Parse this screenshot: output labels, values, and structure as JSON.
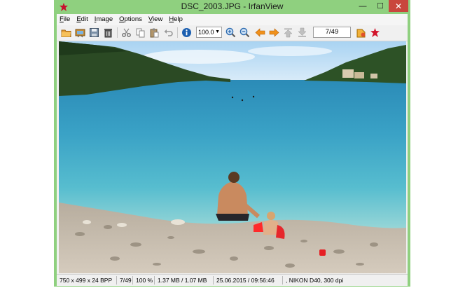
{
  "window": {
    "title": "DSC_2003.JPG - IrfanView",
    "controls": {
      "minimize": "—",
      "maximize": "☐",
      "close": "✕"
    }
  },
  "menu": [
    {
      "label_rest": "ile",
      "accel": "F"
    },
    {
      "label_rest": "dit",
      "accel": "E"
    },
    {
      "label_rest": "mage",
      "accel": "I"
    },
    {
      "label_rest": "ptions",
      "accel": "O"
    },
    {
      "label_rest": "iew",
      "accel": "V"
    },
    {
      "label_rest": "elp",
      "accel": "H"
    }
  ],
  "toolbar": {
    "zoom_value": "100.0",
    "page_counter": "7/49",
    "icons": [
      "open-folder-icon",
      "slideshow-icon",
      "save-icon",
      "delete-icon",
      "cut-icon",
      "copy-icon",
      "paste-icon",
      "undo-icon",
      "info-icon",
      "zoom-in-icon",
      "zoom-out-icon",
      "previous-arrow-icon",
      "next-arrow-icon",
      "first-image-icon",
      "last-image-icon",
      "thumbnails-icon",
      "irfanview-logo-icon"
    ]
  },
  "statusbar": {
    "dimensions": "750 x 499 x 24 BPP",
    "index": "7/49",
    "zoom": "100 %",
    "filesize": "1.37 MB / 1.07 MB",
    "datetime": "25.06.2015 / 09:56:46",
    "camera": ", NIKON D40, 300 dpi"
  },
  "colors": {
    "titlebar": "#8fd07f",
    "close_button": "#c9463d",
    "sea": "#3fa6c4",
    "sky": "#cfe8f8"
  }
}
